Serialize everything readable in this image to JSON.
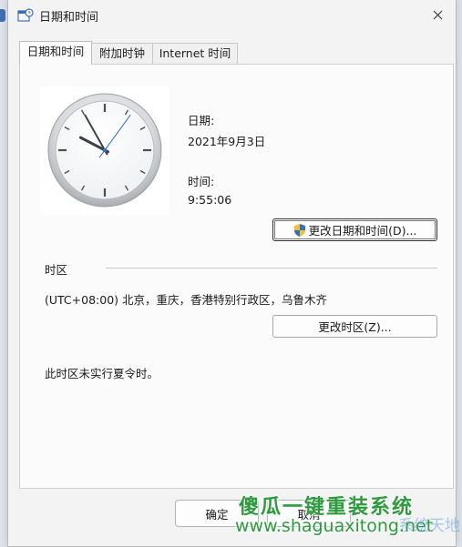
{
  "window": {
    "title": "日期和时间"
  },
  "tabs": [
    {
      "label": "日期和时间"
    },
    {
      "label": "附加时钟"
    },
    {
      "label": "Internet 时间"
    }
  ],
  "datetime": {
    "date_label": "日期:",
    "date_value": "2021年9月3日",
    "time_label": "时间:",
    "time_value": "9:55:06",
    "change_button": "更改日期和时间(D)..."
  },
  "timezone": {
    "section_label": "时区",
    "current": "(UTC+08:00) 北京，重庆，香港特别行政区，乌鲁木齐",
    "change_button": "更改时区(Z)...",
    "dst_note": "此时区未实行夏令时。"
  },
  "footer": {
    "ok_label": "确定",
    "cancel_label": "取消"
  },
  "watermark": {
    "title": "傻瓜一键重装系统",
    "url": "www.shaguaxitong.net",
    "logo_text": "系统天地"
  },
  "clock": {
    "hours": 9,
    "minutes": 55,
    "seconds": 6
  },
  "icons": [
    "datetime-app-icon",
    "close-icon",
    "uac-shield-icon"
  ]
}
